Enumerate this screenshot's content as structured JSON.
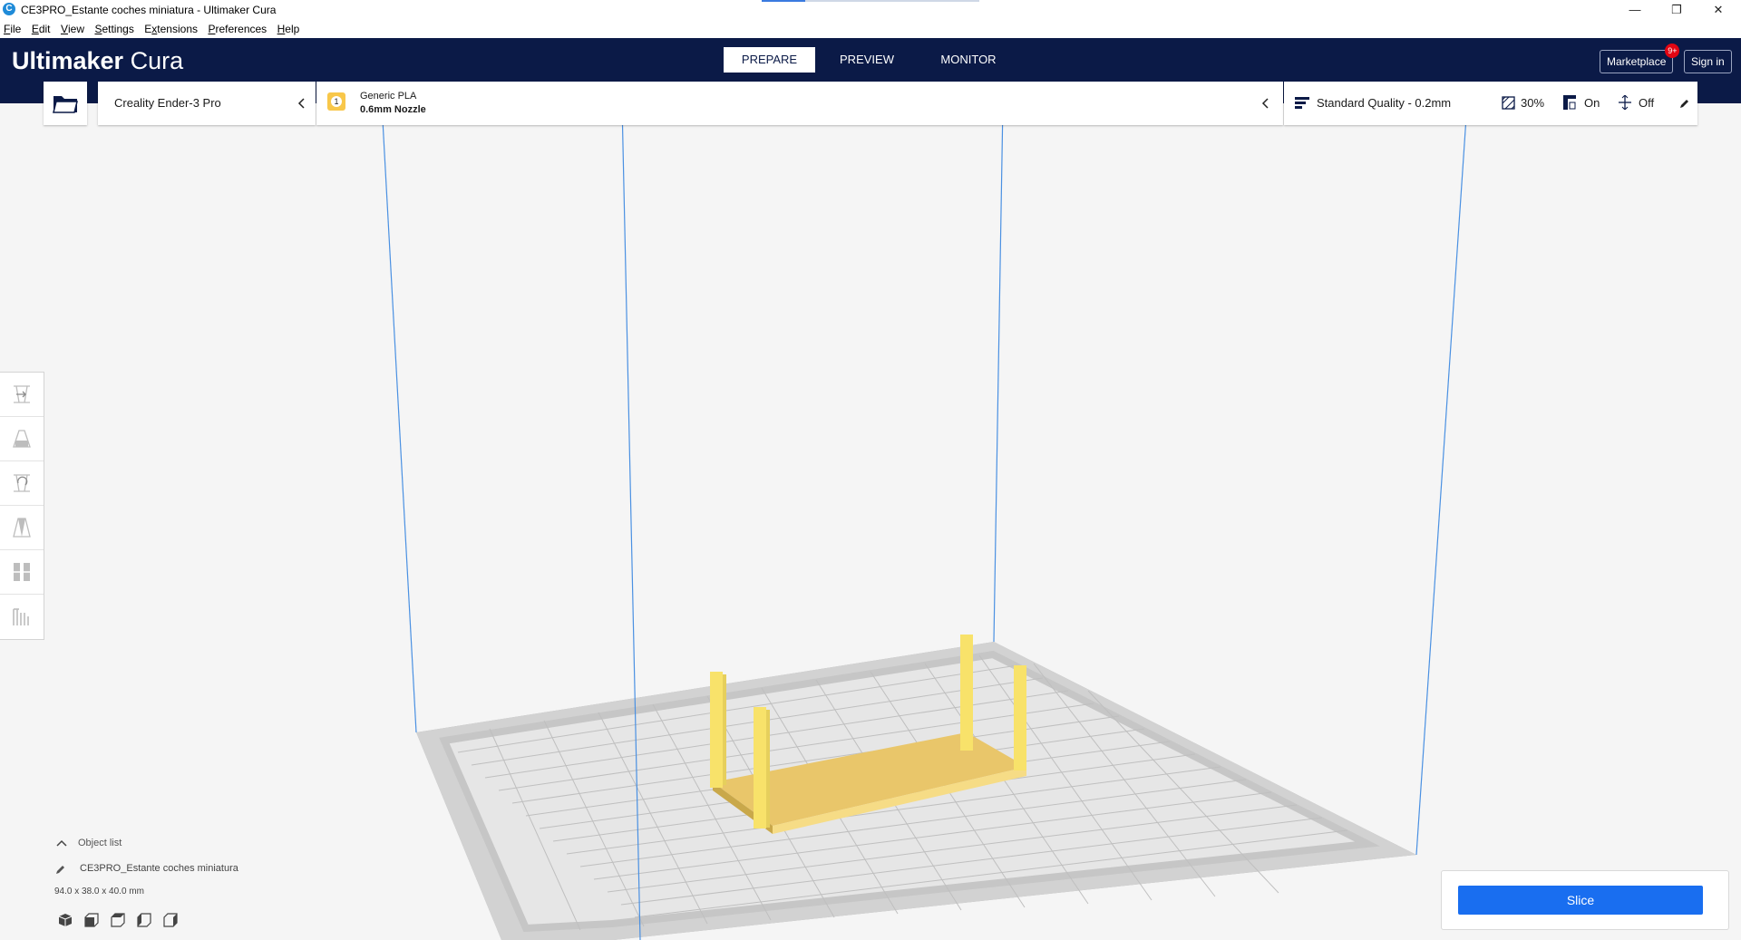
{
  "window": {
    "title": "CE3PRO_Estante coches miniatura - Ultimaker Cura",
    "app_icon_letter": "C",
    "controls": {
      "minimize": "—",
      "maximize": "❐",
      "close": "✕"
    }
  },
  "menubar": {
    "items": [
      {
        "label": "File",
        "mnemonic": "F",
        "rest": "ile"
      },
      {
        "label": "Edit",
        "mnemonic": "E",
        "rest": "dit"
      },
      {
        "label": "View",
        "mnemonic": "V",
        "rest": "iew"
      },
      {
        "label": "Settings",
        "mnemonic": "S",
        "rest": "ettings"
      },
      {
        "label": "Extensions",
        "mnemonic": "x",
        "rest_before": "E",
        "rest": "tensions"
      },
      {
        "label": "Preferences",
        "mnemonic": "P",
        "rest": "references"
      },
      {
        "label": "Help",
        "mnemonic": "H",
        "rest": "elp"
      }
    ]
  },
  "header": {
    "logo_bold": "Ultimaker",
    "logo_light": "Cura",
    "tabs": [
      {
        "label": "PREPARE",
        "active": true
      },
      {
        "label": "PREVIEW",
        "active": false
      },
      {
        "label": "MONITOR",
        "active": false
      }
    ],
    "marketplace_label": "Marketplace",
    "marketplace_badge": "9+",
    "signin_label": "Sign in"
  },
  "printer": {
    "name": "Creality Ender-3 Pro"
  },
  "material": {
    "extruder_number": "1",
    "name": "Generic PLA",
    "nozzle": "0.6mm Nozzle"
  },
  "print_settings": {
    "profile": "Standard Quality - 0.2mm",
    "infill": "30%",
    "support": "On",
    "adhesion": "Off"
  },
  "left_toolbar": {
    "tools": [
      "move-tool-icon",
      "scale-tool-icon",
      "rotate-tool-icon",
      "mirror-tool-icon",
      "per-model-settings-icon",
      "support-blocker-icon"
    ]
  },
  "object_list": {
    "header": "Object list",
    "item_name": "CE3PRO_Estante coches miniatura",
    "dimensions": "94.0 x 38.0 x 40.0 mm"
  },
  "action_panel": {
    "slice_label": "Slice"
  },
  "colors": {
    "header_bg": "#0b1a47",
    "accent_blue": "#196ef0",
    "model_yellow": "#f8e26a",
    "build_plate": "#dcdcdc",
    "volume_lines": "#4a90e2"
  }
}
